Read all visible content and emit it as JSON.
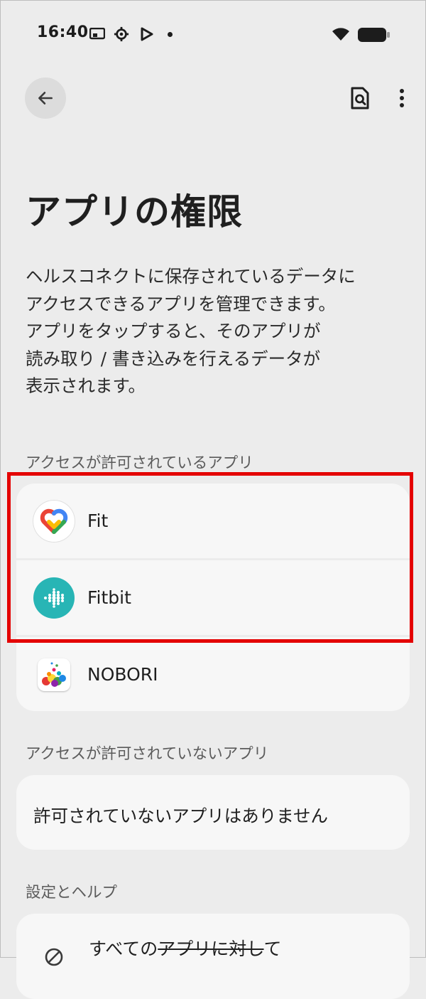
{
  "status_bar": {
    "time": "16:40",
    "icons": [
      "cast-icon",
      "settings-icon",
      "play-store-icon",
      "notification-dot",
      "wifi-icon",
      "battery-icon"
    ]
  },
  "app_bar": {
    "back_icon": "arrow-back-icon",
    "actions": [
      "search-document-icon",
      "more-vert-icon"
    ]
  },
  "page": {
    "title": "アプリの権限",
    "description": "ヘルスコネクトに保存されているデータに\nアクセスできるアプリを管理できます。\nアプリをタップすると、そのアプリが\n読み取り / 書き込みを行えるデータが\n表示されます。"
  },
  "allowed": {
    "header": "アクセスが許可されているアプリ",
    "apps": [
      {
        "name": "Fit",
        "icon": "google-fit-icon"
      },
      {
        "name": "Fitbit",
        "icon": "fitbit-icon"
      },
      {
        "name": "NOBORI",
        "icon": "nobori-icon"
      }
    ]
  },
  "not_allowed": {
    "header": "アクセスが許可されていないアプリ",
    "empty_message": "許可されていないアプリはありません"
  },
  "settings": {
    "header": "設定とヘルプ",
    "item_prefix": "すべての",
    "item_strike": "アプリに対し",
    "item_suffix": "て",
    "item_icon": "block-icon"
  },
  "colors": {
    "background": "#ececec",
    "card": "#f7f7f7",
    "highlight": "#e40000",
    "fitbit": "#28b5b5"
  }
}
